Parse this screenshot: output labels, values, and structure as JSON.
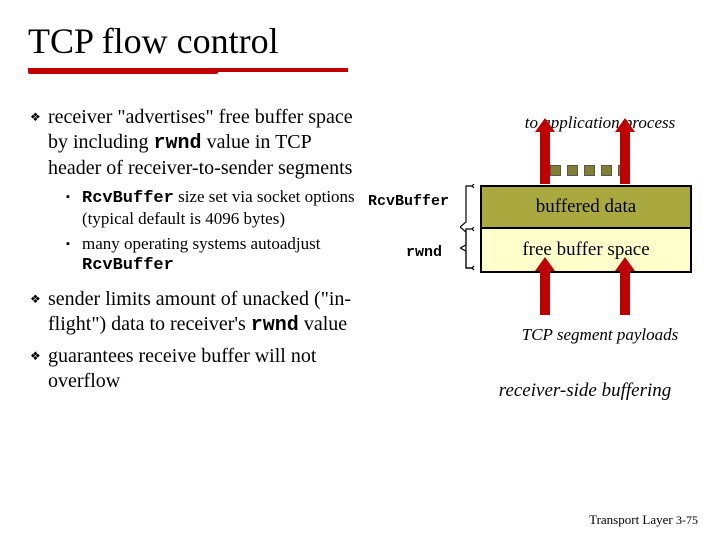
{
  "title": "TCP flow control",
  "bullets": [
    {
      "pre": "receiver \"advertises\" free buffer space by including ",
      "code": "rwnd",
      "post": " value in TCP header of receiver-to-sender segments"
    },
    {
      "pre": "sender limits amount of unacked (\"in-flight\") data to receiver's ",
      "code": "rwnd",
      "post": " value"
    },
    {
      "pre": "guarantees receive buffer will not overflow",
      "code": "",
      "post": ""
    }
  ],
  "subbullets": [
    {
      "code": "RcvBuffer",
      "post": " size set via socket options (typical default is 4096 bytes)"
    },
    {
      "pre": "many operating systems autoadjust ",
      "code": "RcvBuffer"
    }
  ],
  "diagram": {
    "app_label": "to application process",
    "buffered_label": "buffered data",
    "free_label": "free buffer space",
    "rcvbuf_label": "RcvBuffer",
    "rwnd_label": "rwnd",
    "segments_label": "TCP segment payloads",
    "caption": "receiver-side buffering"
  },
  "footer": {
    "chapter": "Transport Layer",
    "page": "3-75"
  }
}
